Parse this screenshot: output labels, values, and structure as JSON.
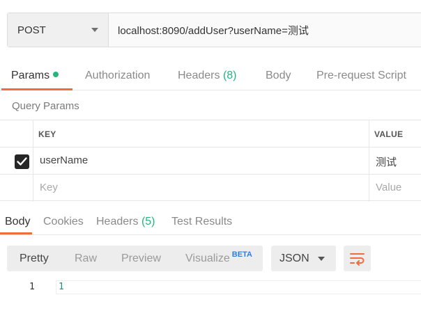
{
  "request": {
    "method": "POST",
    "url": "localhost:8090/addUser?userName=测试"
  },
  "request_tabs": {
    "params": "Params",
    "authorization": "Authorization",
    "headers": "Headers",
    "headers_count": "(8)",
    "body": "Body",
    "pre_request": "Pre-request Script"
  },
  "query_params": {
    "title": "Query Params",
    "columns": {
      "key": "KEY",
      "value": "VALUE"
    },
    "rows": [
      {
        "checked": true,
        "key": "userName",
        "value": "测试"
      }
    ],
    "placeholder": {
      "key": "Key",
      "value": "Value"
    }
  },
  "response_tabs": {
    "body": "Body",
    "cookies": "Cookies",
    "headers": "Headers",
    "headers_count": "(5)",
    "test_results": "Test Results"
  },
  "response_toolbar": {
    "pretty": "Pretty",
    "raw": "Raw",
    "preview": "Preview",
    "visualize": "Visualize",
    "beta": "BETA",
    "format": "JSON",
    "wrap_icon": "wrap-lines-icon"
  },
  "editor": {
    "line_number": "1",
    "content": "1"
  },
  "colors": {
    "accent": "#f26b3a",
    "green": "#26b47f",
    "beta_blue": "#2f7fe0"
  }
}
